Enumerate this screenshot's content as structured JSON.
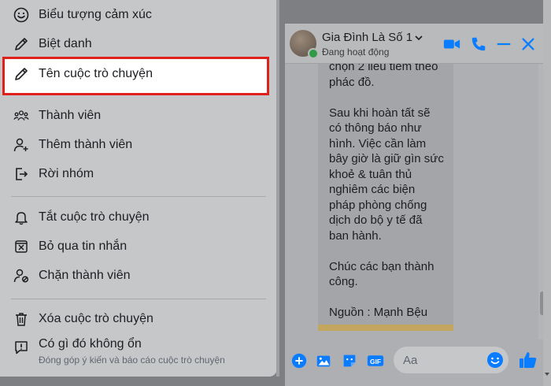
{
  "menu": {
    "items": [
      {
        "label": "Biểu tượng cảm xúc",
        "icon": "smile-icon"
      },
      {
        "label": "Biệt danh",
        "icon": "pencil-icon"
      },
      {
        "label": "Tên cuộc trò chuyện",
        "icon": "pencil-icon"
      },
      {
        "label": "Thành viên",
        "icon": "group-icon"
      },
      {
        "label": "Thêm thành viên",
        "icon": "add-person-icon"
      },
      {
        "label": "Rời nhóm",
        "icon": "leave-icon"
      },
      {
        "label": "Tắt cuộc trò chuyện",
        "icon": "bell-icon"
      },
      {
        "label": "Bỏ qua tin nhắn",
        "icon": "ignore-icon"
      },
      {
        "label": "Chặn thành viên",
        "icon": "block-person-icon"
      },
      {
        "label": "Xóa cuộc trò chuyện",
        "icon": "trash-icon"
      },
      {
        "label": "Có gì đó không ổn",
        "sublabel": "Đóng góp ý kiến và báo cáo cuộc trò chuyện",
        "icon": "report-icon"
      }
    ]
  },
  "chat": {
    "name": "Gia Đình Là Số 1",
    "status": "Đang hoạt động",
    "message": "chọn 2 liều tiêm theo\nphác đồ.\n\nSau khi hoàn tất sẽ\ncó thông báo như\nhình. Việc cần làm\nbây giờ là giữ gìn sức\nkhoẻ & tuân thủ\nnghiêm các biện\npháp phòng chống\ndịch do bộ  y tế đã\nban hành.\n\nChúc các bạn thành\ncông.\n\nNguồn : Mạnh Bệu",
    "input_placeholder": "Aa",
    "gif_label": "GIF"
  },
  "colors": {
    "accent": "#0a7cff",
    "highlight_border": "#e0201b",
    "online": "#2f9b45"
  }
}
